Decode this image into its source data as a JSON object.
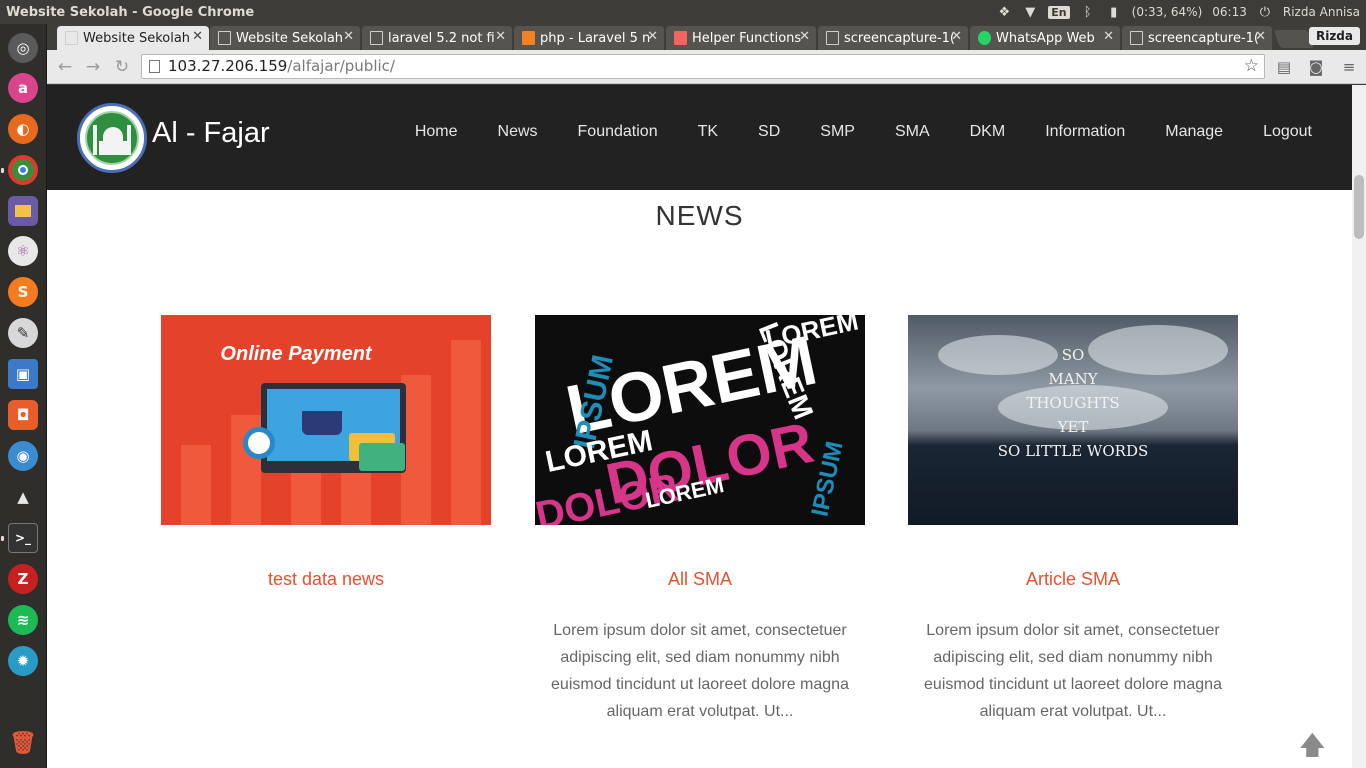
{
  "os": {
    "window_title": "Website Sekolah - Google Chrome",
    "tray": {
      "language": "En",
      "battery": "(0:33, 64%)",
      "time": "06:13",
      "user": "Rizda Annisa"
    }
  },
  "launcher": {
    "apps": [
      "ubuntu-dash-icon",
      "aptana-icon",
      "firefox-icon",
      "chrome-icon",
      "files-icon",
      "atom-icon",
      "sublime-text-icon",
      "inkscape-icon",
      "virtualbox-icon",
      "software-center-icon",
      "shutter-icon",
      "vlc-icon",
      "terminal-icon",
      "filezilla-icon",
      "spotify-icon",
      "update-manager-icon",
      "trash-icon"
    ]
  },
  "browser": {
    "tabs": [
      {
        "label": "Website Sekolah",
        "active": true
      },
      {
        "label": "Website Sekolah"
      },
      {
        "label": "laravel 5.2 not fi"
      },
      {
        "label": "php - Laravel 5 n"
      },
      {
        "label": "Helper Functions"
      },
      {
        "label": "screencapture-1("
      },
      {
        "label": "WhatsApp Web"
      },
      {
        "label": "screencapture-1("
      }
    ],
    "profile": "Rizda",
    "address": {
      "host": "103.27.206.159",
      "path": "/alfajar/public/"
    }
  },
  "site": {
    "brand": "Al - Fajar",
    "nav": [
      "Home",
      "News",
      "Foundation",
      "TK",
      "SD",
      "SMP",
      "SMA",
      "DKM",
      "Information",
      "Manage",
      "Logout"
    ],
    "section_title": "NEWS",
    "cards": [
      {
        "title": "test data news",
        "description": "",
        "image_text": "Online Payment"
      },
      {
        "title": "All SMA",
        "description": "Lorem ipsum dolor sit amet, consectetuer adipiscing elit, sed diam nonummy nibh euismod tincidunt ut laoreet dolore magna aliquam erat volutpat. Ut...",
        "image_words": [
          "LOREM",
          "DOLOR",
          "IPSUM",
          "LOREM",
          "LOREM",
          "DOLOR",
          "LOREM",
          "IPSUM",
          "LOREM"
        ]
      },
      {
        "title": "Article SMA",
        "description": "Lorem ipsum dolor sit amet, consectetuer adipiscing elit, sed diam nonummy nibh euismod tincidunt ut laoreet dolore magna aliquam erat volutpat. Ut...",
        "image_quote": [
          "SO",
          "MANY",
          "THOUGHTS",
          "YET",
          "SO LITTLE WORDS"
        ]
      }
    ],
    "to_top_icon": "arrow-up-icon"
  }
}
